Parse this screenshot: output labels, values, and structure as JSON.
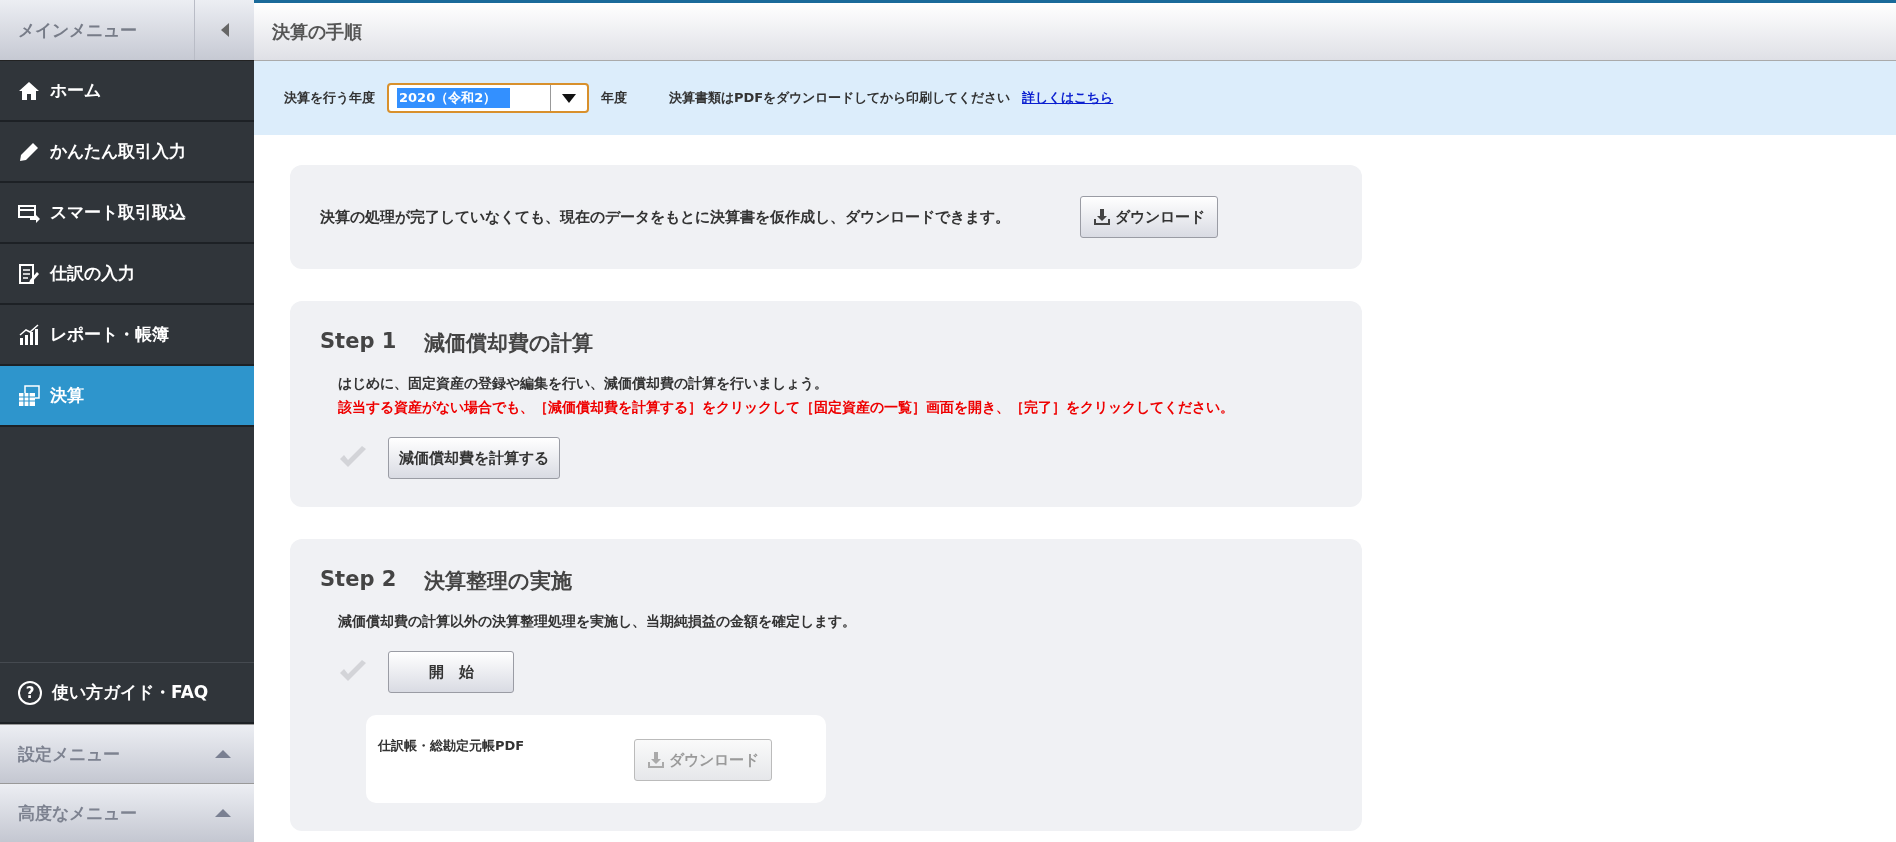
{
  "sidebar": {
    "title": "メインメニュー",
    "items": [
      {
        "label": "ホーム",
        "selected": false
      },
      {
        "label": "かんたん取引入力",
        "selected": false
      },
      {
        "label": "スマート取引取込",
        "selected": false
      },
      {
        "label": "仕訳の入力",
        "selected": false
      },
      {
        "label": "レポート・帳簿",
        "selected": false
      },
      {
        "label": "決算",
        "selected": true
      }
    ],
    "guide_icon": "?",
    "guide": "使い方ガイド・FAQ",
    "sections": [
      {
        "label": "設定メニュー",
        "expanded": false
      },
      {
        "label": "高度なメニュー",
        "expanded": false
      }
    ]
  },
  "page_title": "決算の手順",
  "toolbar": {
    "year_label": "決算を行う年度",
    "year_value": "2020（令和2）",
    "year_suffix": "年度",
    "notice": "決算書類はPDFをダウンロードしてから印刷してください",
    "link": "詳しくはこちら"
  },
  "draft": {
    "text": "決算の処理が完了していなくても、現在のデータをもとに決算書を仮作成し、ダウンロードできます。",
    "button": {
      "label": "ダウンロード",
      "disabled": false
    }
  },
  "steps": [
    {
      "step": "Step 1",
      "title": "減価償却費の計算",
      "description": "はじめに、固定資産の登録や編集を行い、減価償却費の計算を行いましょう。",
      "warning": "該当する資産がない場合でも、［減価償却費を計算する］をクリックして［固定資産の一覧］画面を開き、［完了］をクリックしてください。",
      "completed": false,
      "button": "減価償却費を計算する"
    },
    {
      "step": "Step 2",
      "title": "決算整理の実施",
      "description": "減価償却費の計算以外の決算整理処理を実施し、当期純損益の金額を確定します。",
      "completed": false,
      "button": "開　始",
      "download": {
        "label": "仕訳帳・総勘定元帳PDF",
        "button": {
          "label": "ダウンロード",
          "disabled": true
        }
      }
    }
  ]
}
